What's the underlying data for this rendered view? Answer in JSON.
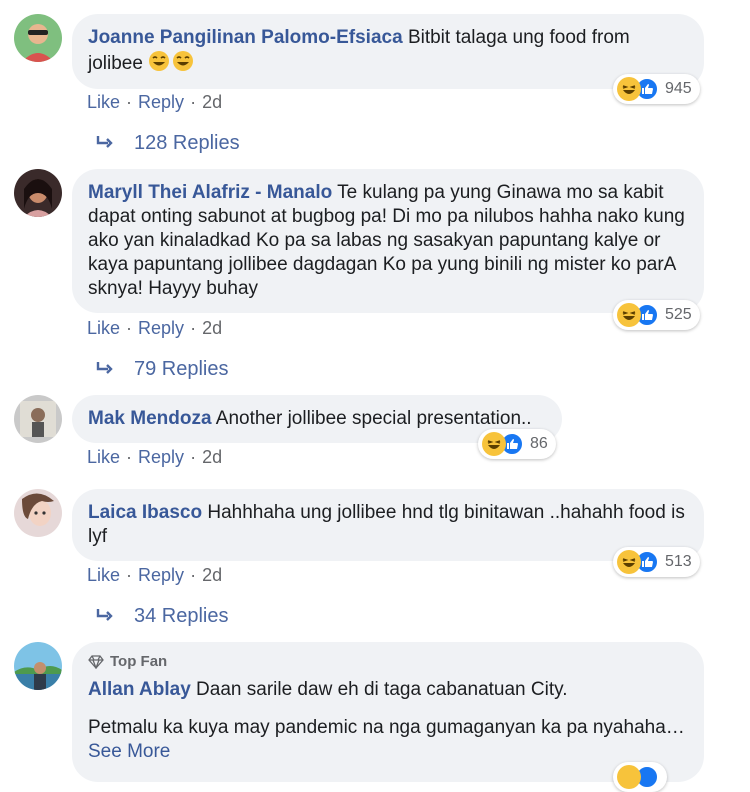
{
  "comments": [
    {
      "author": "Joanne Pangilinan Palomo-Efsiaca",
      "text": "Bitbit talaga ung food from jolibee",
      "like": "Like",
      "reply": "Reply",
      "time": "2d",
      "reaction_count": "945",
      "replies": "128 Replies"
    },
    {
      "author": "Maryll Thei Alafriz - Manalo",
      "text": "Te kulang pa yung Ginawa mo sa kabit dapat onting sabunot at bugbog pa! Di mo pa nilubos hahha nako kung ako yan kinaladkad Ko pa sa labas ng sasakyan papuntang kalye or kaya papuntang jollibee dagdagan Ko pa yung binili ng mister ko parA sknya! Hayyy buhay",
      "like": "Like",
      "reply": "Reply",
      "time": "2d",
      "reaction_count": "525",
      "replies": "79 Replies"
    },
    {
      "author": "Mak Mendoza",
      "text": "Another jollibee special presentation..",
      "like": "Like",
      "reply": "Reply",
      "time": "2d",
      "reaction_count": "86"
    },
    {
      "author": "Laica Ibasco",
      "text": "Hahhhaha ung jollibee hnd tlg binitawan ..hahahh food is lyf",
      "like": "Like",
      "reply": "Reply",
      "time": "2d",
      "reaction_count": "513",
      "replies": "34 Replies"
    },
    {
      "badge": "Top Fan",
      "author": "Allan Ablay",
      "text": "Daan sarile daw eh di taga cabanatuan City.",
      "text2": "Petmalu ka kuya may pandemic na nga gumaganyan ka pa nyahaha…",
      "see_more": "See More"
    }
  ],
  "colors": {
    "author": "#385898",
    "link": "#4b67a1",
    "bubble": "#f0f2f5",
    "haha": "#f7c33b",
    "like": "#1877f2"
  }
}
